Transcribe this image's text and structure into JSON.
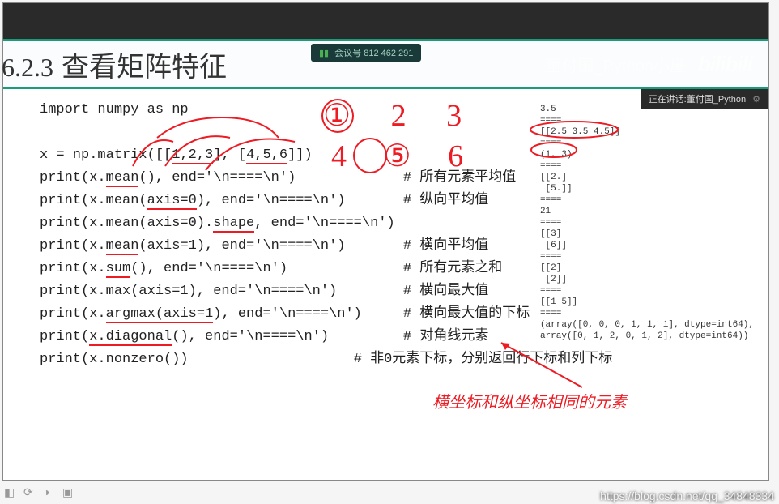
{
  "meeting": {
    "label": "会议号",
    "number": "812 462 291"
  },
  "header": {
    "section_number": "6.2.3",
    "section_title": "查看矩阵特征",
    "author_wm": "董付国_Python小屋",
    "site_logo": "bilibili"
  },
  "speaker": {
    "prefix": "正在讲话:",
    "name": "董付国_Python"
  },
  "code": {
    "l1": "import numpy as np",
    "l2": "",
    "l3a": "x = np.matrix([[",
    "l3b": "1,2,3",
    "l3c": "], [",
    "l3d": "4,5,6",
    "l3e": "]])",
    "l4a": "print(x.",
    "l4m": "mean",
    "l4b": "(), end='\\n====\\n')",
    "l4c": "# 所有元素平均值",
    "l5a": "print(x.mean(",
    "l5ax": "axis=0",
    "l5b": "), end='\\n====\\n')",
    "l5c": "# 纵向平均值",
    "l6a": "print(x.mean(axis=0).",
    "l6sh": "shape",
    "l6b": ", end='\\n====\\n')",
    "l7a": "print(x.",
    "l7m": "mean",
    "l7b": "(axis=1), end='\\n====\\n')",
    "l7c": "# 横向平均值",
    "l8a": "print(x.",
    "l8s": "sum",
    "l8b": "(), end='\\n====\\n')",
    "l8c": "# 所有元素之和",
    "l9a": "print(x.max(axis=1), end='\\n====\\n')",
    "l9c": "# 横向最大值",
    "l10a": "print(x.",
    "l10am": "argmax(axis=1",
    "l10b": "), end='\\n====\\n')",
    "l10c": "# 横向最大值的下标",
    "l11a": "print(",
    "l11d": "x.diagonal",
    "l11b": "(), end='\\n====\\n')",
    "l11c": "# 对角线元素",
    "l12a": "print(x.nonzero())",
    "l12c": "# 非0元素下标，分别返回行下标和列下标"
  },
  "output": "3.5\n====\n[[2.5 3.5 4.5]]\n====\n(1, 3)\n====\n[[2.]\n [5.]]\n====\n21\n====\n[[3]\n [6]]\n====\n[[2]\n [2]]\n====\n[[1 5]]\n====\n(array([0, 0, 0, 1, 1, 1], dtype=int64),\narray([0, 1, 2, 0, 1, 2], dtype=int64))",
  "annotations": {
    "nums123": "① 2  3",
    "nums456": "4 ⑤ 6",
    "bottom_text": "横坐标和纵坐标相同的元素"
  },
  "csdn": "https://blog.csdn.net/qq_34848334"
}
